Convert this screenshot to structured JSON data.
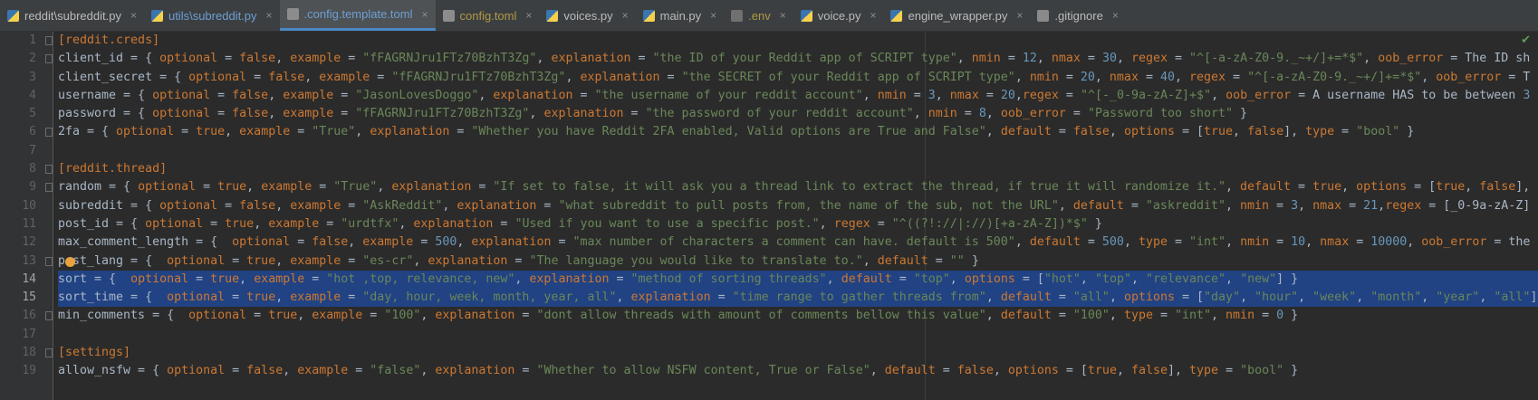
{
  "tabs": [
    {
      "label": "reddit\\subreddit.py",
      "icon": "python-file-icon",
      "type": "py",
      "style": ""
    },
    {
      "label": "utils\\subreddit.py",
      "icon": "python-file-icon",
      "type": "py",
      "style": "mod-blue"
    },
    {
      "label": ".config.template.toml",
      "icon": "toml-file-icon",
      "type": "toml",
      "style": "mod-blue",
      "active": true
    },
    {
      "label": "config.toml",
      "icon": "toml-file-icon",
      "type": "toml",
      "style": "mod-olive"
    },
    {
      "label": "voices.py",
      "icon": "python-file-icon",
      "type": "py",
      "style": ""
    },
    {
      "label": "main.py",
      "icon": "python-file-icon",
      "type": "py",
      "style": ""
    },
    {
      "label": ".env",
      "icon": "env-file-icon",
      "type": "env",
      "style": "mod-olive"
    },
    {
      "label": "voice.py",
      "icon": "python-file-icon",
      "type": "py",
      "style": ""
    },
    {
      "label": "engine_wrapper.py",
      "icon": "python-file-icon",
      "type": "py",
      "style": ""
    },
    {
      "label": ".gitignore",
      "icon": "gitignore-file-icon",
      "type": "git",
      "style": ""
    }
  ],
  "editor": {
    "lines": [
      {
        "num": "1",
        "text": "[reddit.creds]"
      },
      {
        "num": "2",
        "text": "client_id = { optional = false, example = \"fFAGRNJru1FTz70BzhT3Zg\", explanation = \"the ID of your Reddit app of SCRIPT type\", nmin = 12, nmax = 30, regex = \"^[-a-zA-Z0-9._~+/]+=*$\", oob_error = \"The ID sh"
      },
      {
        "num": "3",
        "text": "client_secret = { optional = false, example = \"fFAGRNJru1FTz70BzhT3Zg\", explanation = \"the SECRET of your Reddit app of SCRIPT type\", nmin = 20, nmax = 40, regex = \"^[-a-zA-Z0-9._~+/]+=*$\", oob_error = \"T"
      },
      {
        "num": "4",
        "text": "username = { optional = false, example = \"JasonLovesDoggo\", explanation = \"the username of your reddit account\", nmin = 3, nmax = 20,regex = \"^[-_0-9a-zA-Z]+$\", oob_error = \"A username HAS to be between 3"
      },
      {
        "num": "5",
        "text": "password = { optional = false, example = \"fFAGRNJru1FTz70BzhT3Zg\", explanation = \"the password of your reddit account\", nmin = 8, oob_error = \"Password too short\" }"
      },
      {
        "num": "6",
        "text": "2fa = { optional = true, example = \"True\", explanation = \"Whether you have Reddit 2FA enabled, Valid options are True and False\", default = false, options = [true, false], type = \"bool\" }"
      },
      {
        "num": "7",
        "text": ""
      },
      {
        "num": "8",
        "text": "[reddit.thread]"
      },
      {
        "num": "9",
        "text": "random = { optional = true, example = \"True\", explanation = \"If set to false, it will ask you a thread link to extract the thread, if true it will randomize it.\", default = true, options = [true, false],"
      },
      {
        "num": "10",
        "text": "subreddit = { optional = false, example = \"AskReddit\", explanation = \"what subreddit to pull posts from, the name of the sub, not the URL\", default = \"askreddit\", nmin = 3, nmax = 21,regex = \"[_0-9a-zA-Z]"
      },
      {
        "num": "11",
        "text": "post_id = { optional = true, example = \"urdtfx\", explanation = \"Used if you want to use a specific post.\", regex = \"^((?!://|://)[+a-zA-Z])*$\" }"
      },
      {
        "num": "12",
        "text": "max_comment_length = {  optional = false, example = 500, explanation = \"max number of characters a comment can have. default is 500\", default = 500, type = \"int\", nmin = 10, nmax = 10000, oob_error = \"the"
      },
      {
        "num": "13",
        "text": "post_lang = {  optional = true, example = \"es-cr\", explanation = \"The language you would like to translate to.\", default = \"\" }"
      },
      {
        "num": "14",
        "text": "sort = {  optional = true, example = \"hot ,top, relevance, new\", explanation = \"method of sorting threads\", default = \"top\", options = [\"hot\", \"top\", \"relevance\", \"new\"] }",
        "sel": true
      },
      {
        "num": "15",
        "text": "sort_time = {  optional = true, example = \"day, hour, week, month, year, all\", explanation = \"time range to gather threads from\", default = \"all\", options = [\"day\", \"hour\", \"week\", \"month\", \"year\", \"all\"]",
        "sel": true
      },
      {
        "num": "16",
        "text": "min_comments = {  optional = true, example = \"100\", explanation = \"dont allow threads with amount of comments bellow this value\", default = \"100\", type = \"int\", nmin = 0 }"
      },
      {
        "num": "17",
        "text": ""
      },
      {
        "num": "18",
        "text": "[settings]"
      },
      {
        "num": "19",
        "text": "allow_nsfw = { optional = false, example = \"false\", explanation = \"Whether to allow NSFW content, True or False\", default = false, options = [true, false], type = \"bool\" }"
      }
    ]
  },
  "colors": {
    "selection": "#214283",
    "keyword": "#cc7832",
    "string": "#6a8759",
    "number": "#6897bb"
  }
}
